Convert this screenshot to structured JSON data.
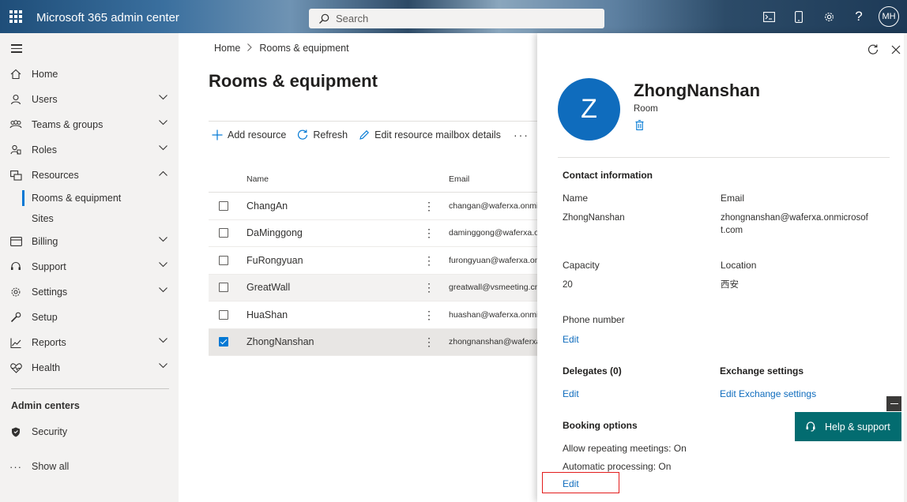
{
  "app": {
    "title": "Microsoft 365 admin center",
    "user_initials": "MH"
  },
  "search": {
    "placeholder": "Search"
  },
  "sidebar": {
    "items": [
      {
        "label": "Home",
        "icon": "home-icon",
        "chevron": false
      },
      {
        "label": "Users",
        "icon": "user-icon",
        "chevron": true
      },
      {
        "label": "Teams & groups",
        "icon": "teams-icon",
        "chevron": true
      },
      {
        "label": "Roles",
        "icon": "roles-icon",
        "chevron": true
      },
      {
        "label": "Resources",
        "icon": "resources-icon",
        "chevron": true
      }
    ],
    "sub_items": [
      "Rooms & equipment",
      "Sites"
    ],
    "items2": [
      {
        "label": "Billing",
        "icon": "billing-icon",
        "chevron": true
      },
      {
        "label": "Support",
        "icon": "support-icon",
        "chevron": true
      },
      {
        "label": "Settings",
        "icon": "settings-icon",
        "chevron": true
      },
      {
        "label": "Setup",
        "icon": "setup-icon",
        "chevron": false
      },
      {
        "label": "Reports",
        "icon": "reports-icon",
        "chevron": true
      },
      {
        "label": "Health",
        "icon": "health-icon",
        "chevron": true
      }
    ],
    "admin_centers_title": "Admin centers",
    "security_label": "Security",
    "show_all_label": "Show all"
  },
  "breadcrumb": {
    "home": "Home",
    "current": "Rooms & equipment"
  },
  "page_title": "Rooms & equipment",
  "toolbar": {
    "add": "Add resource",
    "refresh": "Refresh",
    "edit": "Edit resource mailbox details",
    "more": "···"
  },
  "table": {
    "headers": {
      "name": "Name",
      "email": "Email"
    },
    "rows": [
      {
        "name": "ChangAn",
        "email": "changan@waferxa.onmicrosoft.com",
        "checked": false
      },
      {
        "name": "DaMinggong",
        "email": "daminggong@waferxa.onmicrosoft.com",
        "checked": false
      },
      {
        "name": "FuRongyuan",
        "email": "furongyuan@waferxa.onmicrosoft.com",
        "checked": false
      },
      {
        "name": "GreatWall",
        "email": "greatwall@vsmeeting.cn",
        "checked": false
      },
      {
        "name": "HuaShan",
        "email": "huashan@waferxa.onmicrosoft.com",
        "checked": false
      },
      {
        "name": "ZhongNanshan",
        "email": "zhongnanshan@waferxa.onmicrosoft.com",
        "checked": true
      }
    ]
  },
  "panel": {
    "avatar_letter": "Z",
    "name": "ZhongNanshan",
    "type": "Room",
    "contact_heading": "Contact information",
    "name_label": "Name",
    "name_value": "ZhongNanshan",
    "email_label": "Email",
    "email_value_line1": "zhongnanshan@waferxa.onmicrosof",
    "email_value_line2": "t.com",
    "capacity_label": "Capacity",
    "capacity_value": "20",
    "location_label": "Location",
    "location_value": "西安",
    "phone_label": "Phone number",
    "phone_edit": "Edit",
    "delegates_heading": "Delegates (0)",
    "delegates_edit": "Edit",
    "exchange_heading": "Exchange settings",
    "exchange_edit": "Edit Exchange settings",
    "booking_heading": "Booking options",
    "booking_repeat": "Allow repeating meetings: On",
    "booking_auto": "Automatic processing: On",
    "booking_edit": "Edit"
  },
  "help": {
    "label": "Help & support"
  },
  "colors": {
    "accent": "#0078d4",
    "help_bg": "#036c70",
    "highlight": "#e31c1c"
  }
}
